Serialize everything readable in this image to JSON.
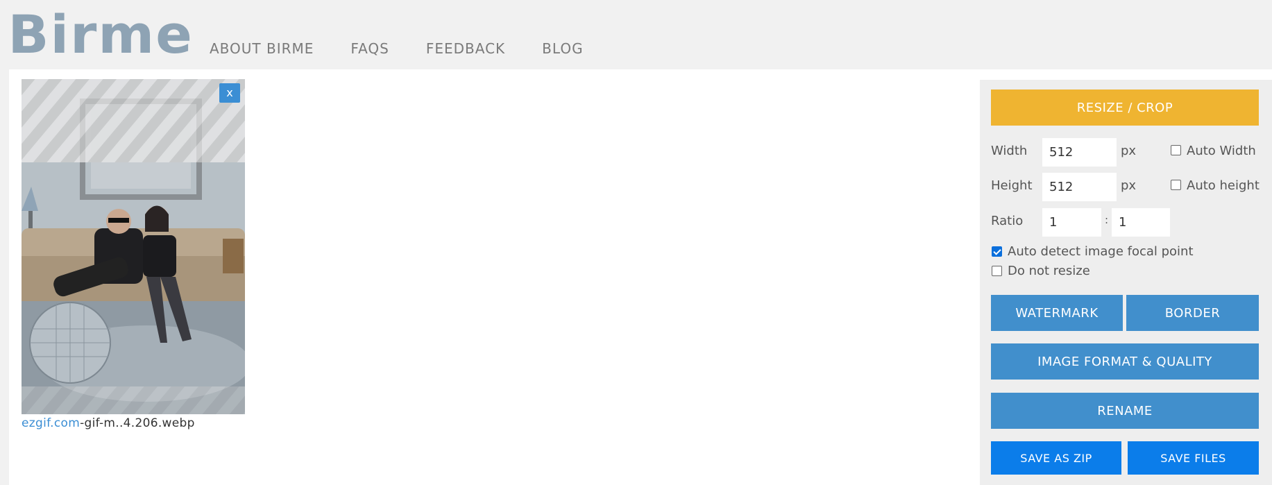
{
  "header": {
    "logo": "Birme",
    "nav": [
      "ABOUT BIRME",
      "FAQS",
      "FEEDBACK",
      "BLOG"
    ]
  },
  "image": {
    "close_label": "x",
    "caption_link": "ezgif.com",
    "caption_rest": "-gif-m..4.206.webp"
  },
  "panel": {
    "resize_crop": "RESIZE / CROP",
    "width_label": "Width",
    "width_value": "512",
    "width_unit": "px",
    "auto_width": "Auto Width",
    "height_label": "Height",
    "height_value": "512",
    "height_unit": "px",
    "auto_height": "Auto height",
    "ratio_label": "Ratio",
    "ratio_w": "1",
    "ratio_sep": ":",
    "ratio_h": "1",
    "focal_point": "Auto detect image focal point",
    "do_not_resize": "Do not resize",
    "watermark": "WATERMARK",
    "border": "BORDER",
    "format_quality": "IMAGE FORMAT & QUALITY",
    "rename": "RENAME",
    "save_zip": "SAVE AS ZIP",
    "save_files": "SAVE FILES"
  },
  "colors": {
    "accent_orange": "#efb431",
    "button_blue": "#418fcc",
    "save_blue": "#0b7dea",
    "logo": "#8ea3b4"
  }
}
